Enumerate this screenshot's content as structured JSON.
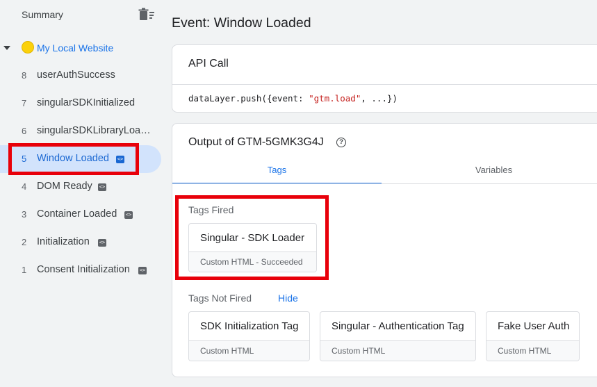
{
  "sidebar": {
    "summary_label": "Summary",
    "site_label": "My Local Website",
    "events": [
      {
        "num": "8",
        "label": "userAuthSuccess",
        "has_code_icon": false
      },
      {
        "num": "7",
        "label": "singularSDKInitialized",
        "has_code_icon": false
      },
      {
        "num": "6",
        "label": "singularSDKLibraryLoaded",
        "has_code_icon": false
      },
      {
        "num": "5",
        "label": "Window Loaded",
        "has_code_icon": true,
        "active": true
      },
      {
        "num": "4",
        "label": "DOM Ready",
        "has_code_icon": true
      },
      {
        "num": "3",
        "label": "Container Loaded",
        "has_code_icon": true
      },
      {
        "num": "2",
        "label": "Initialization",
        "has_code_icon": true
      },
      {
        "num": "1",
        "label": "Consent Initialization",
        "has_code_icon": true
      }
    ]
  },
  "main": {
    "title": "Event: Window Loaded",
    "api_call": {
      "title": "API Call",
      "code_prefix": "dataLayer.push({event: ",
      "code_string": "\"gtm.load\"",
      "code_suffix": ", ...})"
    },
    "output": {
      "title": "Output of GTM-5GMK3G4J",
      "tabs": [
        {
          "label": "Tags",
          "active": true
        },
        {
          "label": "Variables",
          "active": false
        }
      ],
      "fired_label": "Tags Fired",
      "fired": [
        {
          "name": "Singular - SDK Loader",
          "type": "Custom HTML - Succeeded"
        }
      ],
      "not_fired_label": "Tags Not Fired",
      "hide_label": "Hide",
      "not_fired": [
        {
          "name": "SDK Initialization Tag",
          "type": "Custom HTML"
        },
        {
          "name": "Singular - Authentication Tag",
          "type": "Custom HTML"
        },
        {
          "name": "Fake User Auth",
          "type": "Custom HTML"
        }
      ]
    }
  },
  "colors": {
    "accent": "#1a73e8",
    "highlight_box": "#e8000a",
    "active_item_bg": "#d2e3fc",
    "site_dot": "#fbd10b"
  },
  "icons": {
    "summary_action": "delete-sweep-icon",
    "site": "site-dot-icon",
    "event_code": "code-icon",
    "help": "help-icon",
    "collapse": "caret-down-icon"
  }
}
